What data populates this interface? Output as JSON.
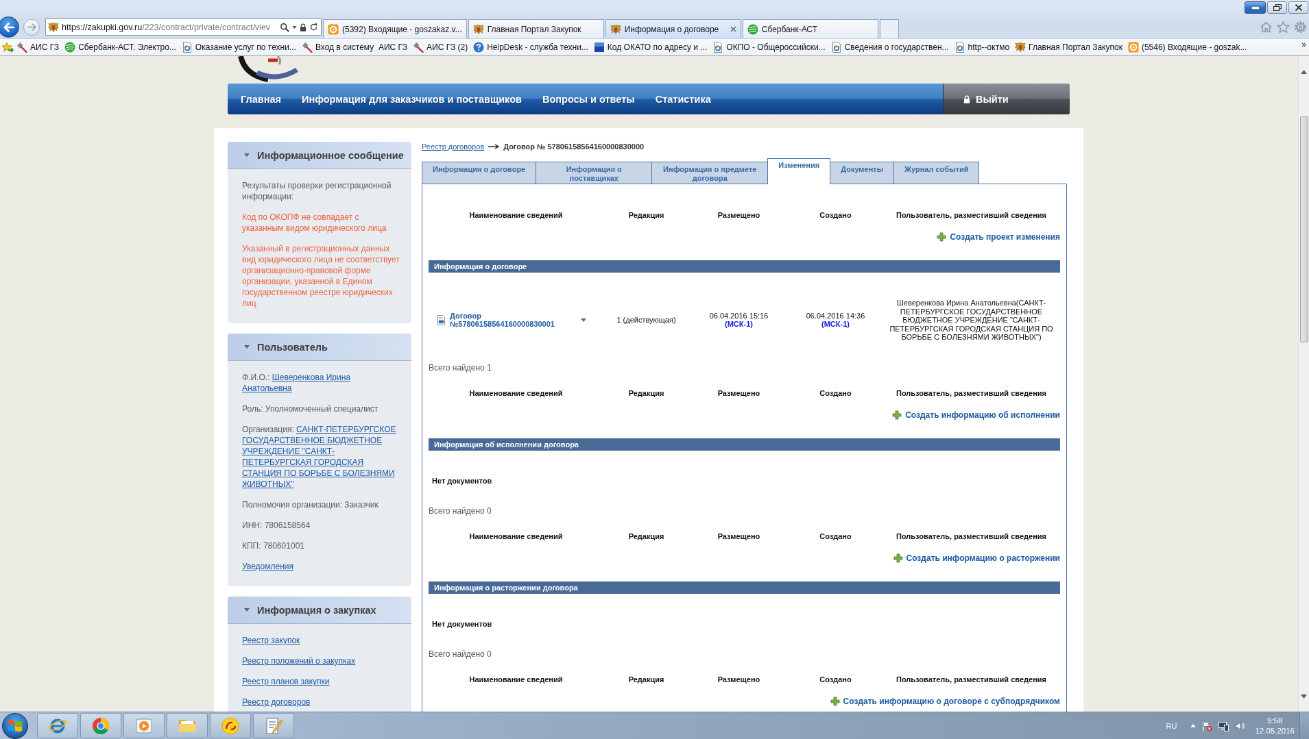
{
  "browser": {
    "url_host": "https://zakupki.gov.ru",
    "url_path": "/223/contract/private/contract/viev",
    "tabs": [
      {
        "title": "(5392) Входящие - goszakaz.v...",
        "selected": false
      },
      {
        "title": "Главная Портал Закупок",
        "selected": false
      },
      {
        "title": "Информация о договоре",
        "selected": true
      },
      {
        "title": "Сбербанк-АСТ",
        "selected": false
      }
    ],
    "favorites": [
      "АИС ГЗ",
      "Сбербанк-АСТ. Электро...",
      "Оказание услуг по техни...",
      "Вход в систему  АИС ГЗ",
      "АИС ГЗ (2)",
      "HelpDesk - служба техни...",
      "Код ОКАТО по адресу и ...",
      "ОКПО - Общероссийски...",
      "Сведения о государствен...",
      "http--октмо",
      "Главная Портал Закупок",
      "(5546) Входящие - goszak..."
    ],
    "favorites_more": "»"
  },
  "site": {
    "nav": [
      "Главная",
      "Информация для заказчиков и поставщиков",
      "Вопросы и ответы",
      "Статистика"
    ],
    "logout": "Выйти"
  },
  "sidebar": [
    {
      "title": "Информационное сообщение",
      "expanded": true,
      "items": [
        {
          "kind": "text",
          "text": "Результаты проверки регистрационной информации:"
        },
        {
          "kind": "warning",
          "text": "Код по ОКОПФ не совпадает с указанным видом юридического лица"
        },
        {
          "kind": "warning",
          "text": "Указанный в регистрационных данных вид юридического лица не соответствует организационно-правовой форме организации, указанной в Едином государственном реестре юридических лиц"
        }
      ]
    },
    {
      "title": "Пользователь",
      "expanded": true,
      "items": [
        {
          "kind": "field",
          "label": "Ф.И.О.:",
          "link": "Шеверенкова Ирина Анатольевна"
        },
        {
          "kind": "text",
          "text": "Роль: Уполномоченный специалист"
        },
        {
          "kind": "field",
          "label": "Организация:",
          "link": "САНКТ-ПЕТЕРБУРГСКОЕ ГОСУДАРСТВЕННОЕ БЮДЖЕТНОЕ УЧРЕЖДЕНИЕ \"САНКТ-ПЕТЕРБУРГСКАЯ ГОРОДСКАЯ СТАНЦИЯ ПО БОРЬБЕ С БОЛЕЗНЯМИ ЖИВОТНЫХ\""
        },
        {
          "kind": "text",
          "text": "Полномочия организации: Заказчик"
        },
        {
          "kind": "text",
          "text": "ИНН: 7806158564"
        },
        {
          "kind": "text",
          "text": "КПП: 780601001"
        },
        {
          "kind": "link",
          "text": "Уведомления"
        }
      ]
    },
    {
      "title": "Информация о закупках",
      "expanded": true,
      "items": [
        {
          "kind": "link",
          "text": "Реестр закупок"
        },
        {
          "kind": "link",
          "text": "Реестр положений о закупках"
        },
        {
          "kind": "link",
          "text": "Реестр планов закупки"
        },
        {
          "kind": "link",
          "text": "Реестр договоров"
        }
      ]
    }
  ],
  "main": {
    "breadcrumb": {
      "link": "Реестр договоров",
      "current": "Договор № 57806158564160000830000"
    },
    "tabs": [
      {
        "label": "Информация о договоре",
        "selected": false
      },
      {
        "label": "Информация о поставщиках",
        "selected": false
      },
      {
        "label": "Информация о предмете договора",
        "selected": false
      },
      {
        "label": "Изменения",
        "selected": true
      },
      {
        "label": "Документы",
        "selected": false
      },
      {
        "label": "Журнал событий",
        "selected": false
      }
    ],
    "sections": [
      {
        "columns": [
          "Наименование сведений",
          "Редакция",
          "Размещено",
          "Создано",
          "Пользователь, разместивший сведения"
        ],
        "action": "Создать проект изменения",
        "title": "Информация о договоре",
        "rows": [
          {
            "name": "Договор №57806158564160000830001",
            "edition": "1 (действующая)",
            "placed": "06.04.2016 15:16",
            "placed_zone": "(МСК-1)",
            "created": "06.04.2016 14:36",
            "created_zone": "(МСК-1)",
            "user": "Шеверенкова Ирина Анатольевна(САНКТ-ПЕТЕРБУРГСКОЕ ГОСУДАРСТВЕННОЕ БЮДЖЕТНОЕ УЧРЕЖДЕНИЕ \"САНКТ-ПЕТЕРБУРГСКАЯ ГОРОДСКАЯ СТАНЦИЯ ПО БОРЬБЕ С БОЛЕЗНЯМИ ЖИВОТНЫХ\")"
          }
        ],
        "total": "Всего найдено 1"
      },
      {
        "columns": [
          "Наименование сведений",
          "Редакция",
          "Размещено",
          "Создано",
          "Пользователь, разместивший сведения"
        ],
        "action": "Создать информацию об исполнении",
        "title": "Информация об исполнении договора",
        "empty": "Нет документов",
        "total": "Всего найдено 0"
      },
      {
        "columns": [
          "Наименование сведений",
          "Редакция",
          "Размещено",
          "Создано",
          "Пользователь, разместивший сведения"
        ],
        "action": "Создать информацию о расторжении",
        "title": "Информация о расторжении договора",
        "empty": "Нет документов",
        "total": "Всего найдено 0"
      },
      {
        "columns": [
          "Наименование сведений",
          "Редакция",
          "Размещено",
          "Создано",
          "Пользователь, разместивший сведения"
        ],
        "action": "Создать информацию о договоре с субподрядчиком"
      }
    ]
  },
  "taskbar": {
    "language": "RU",
    "time": "9:58",
    "date": "12.05.2016"
  }
}
